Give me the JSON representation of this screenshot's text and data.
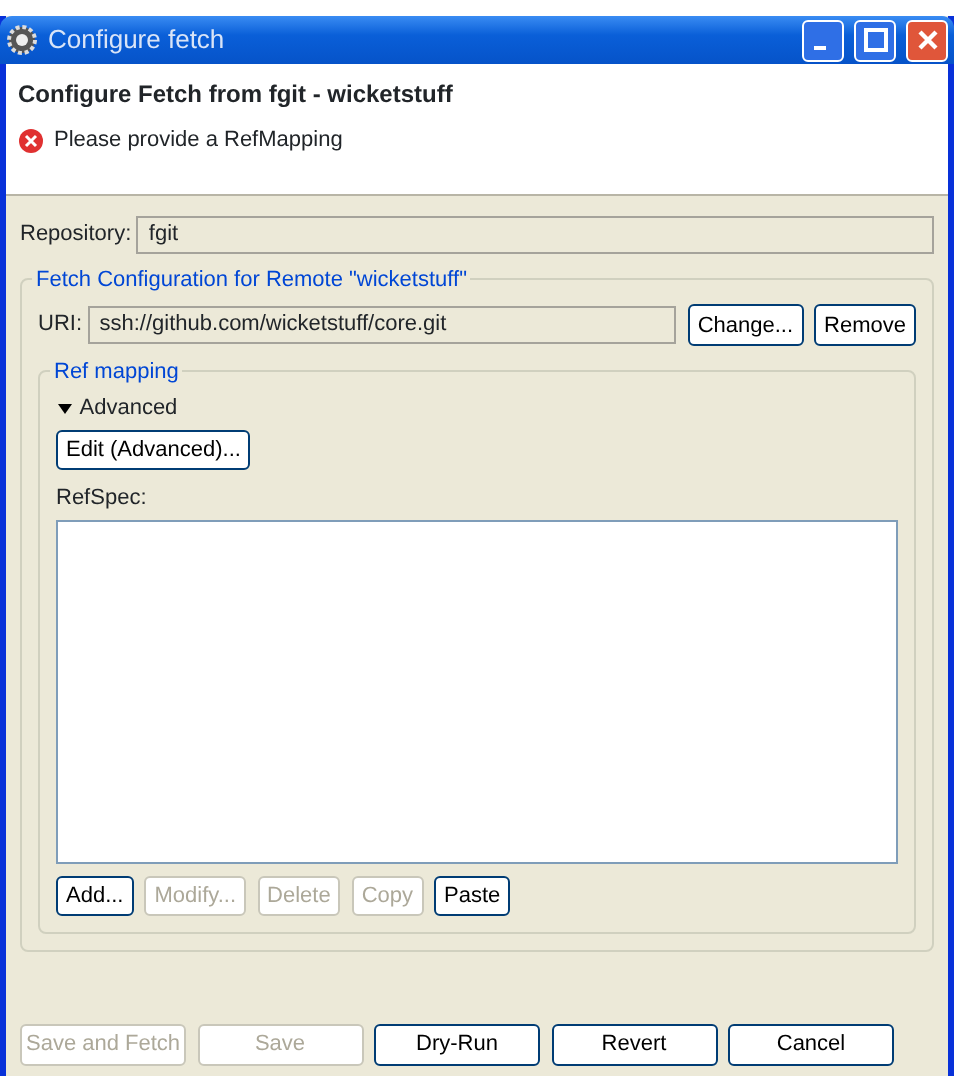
{
  "window": {
    "title": "Configure fetch"
  },
  "header": {
    "title": "Configure Fetch from fgit - wicketstuff",
    "message": {
      "kind": "error",
      "text": "Please provide a RefMapping"
    }
  },
  "repository": {
    "label": "Repository:",
    "value": "fgit"
  },
  "remote_group": {
    "title": "Fetch Configuration for Remote \"wicketstuff\"",
    "uri_label": "URI:",
    "uri_value": "ssh://github.com/wicketstuff/core.git",
    "buttons": [
      {
        "label": "Change...",
        "disabled": false
      },
      {
        "label": "Remove",
        "disabled": false
      }
    ]
  },
  "ref_mapping": {
    "title": "Ref mapping",
    "advanced": {
      "label": "Advanced",
      "expanded": true
    },
    "edit_button": {
      "label": "Edit (Advanced)...",
      "disabled": false
    },
    "refspec_label": "RefSpec:",
    "buttons": [
      {
        "label": "Add...",
        "disabled": false
      },
      {
        "label": "Modify...",
        "disabled": true
      },
      {
        "label": "Delete",
        "disabled": true
      },
      {
        "label": "Copy",
        "disabled": true
      },
      {
        "label": "Paste",
        "disabled": false
      }
    ]
  },
  "footer_buttons": [
    {
      "label": "Save and Fetch",
      "disabled": true
    },
    {
      "label": "Save",
      "disabled": true
    },
    {
      "label": "Dry-Run",
      "disabled": false
    },
    {
      "label": "Revert",
      "disabled": false
    },
    {
      "label": "Cancel",
      "disabled": false
    }
  ]
}
